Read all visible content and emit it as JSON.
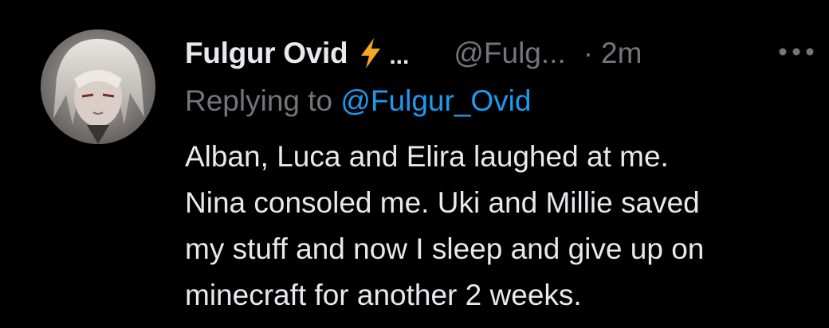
{
  "tweet": {
    "author_name": "Fulgur Ovid",
    "name_ellipsis": "...",
    "handle": "@Fulg...",
    "separator": "·",
    "time": "2m",
    "reply_prefix": "Replying to ",
    "reply_mention": "@Fulgur_Ovid",
    "text_lines": [
      "Alban, Luca and Elira laughed at me.",
      "Nina consoled me. Uki and Millie saved",
      "my stuff and now I sleep and give up on",
      "minecraft for another 2 weeks."
    ]
  },
  "icons": {
    "badge": "lightning-bolt-icon",
    "more": "more-options-icon"
  },
  "colors": {
    "background": "#000000",
    "text": "#e7e9ea",
    "secondary": "#71767b",
    "link": "#1d9bf0",
    "bolt": "#f4a623"
  }
}
